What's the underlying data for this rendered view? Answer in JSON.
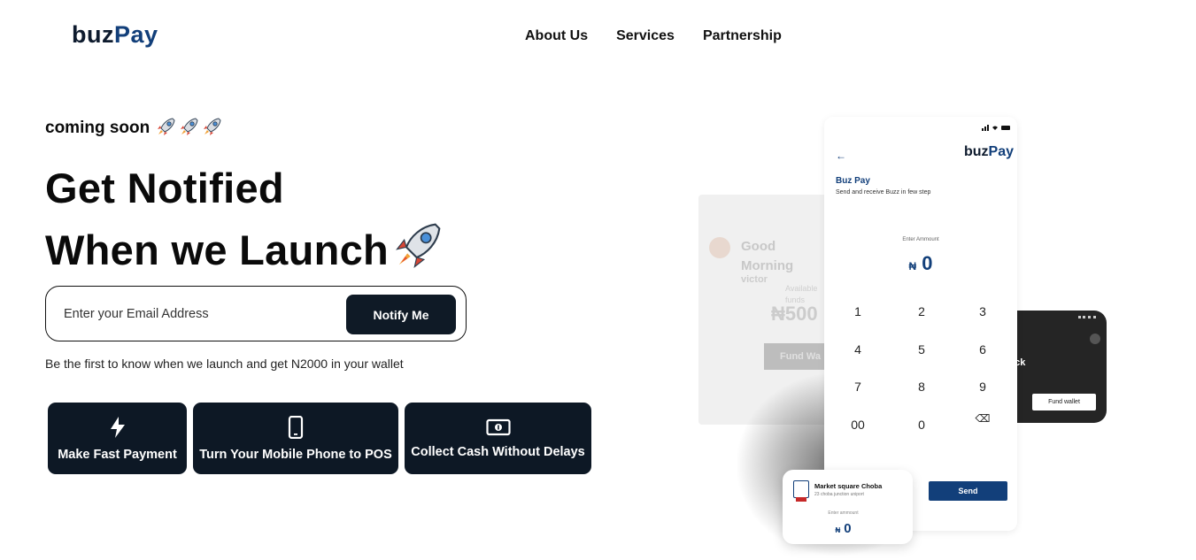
{
  "nav": {
    "logo_part1": "buz",
    "logo_part2": "Pay",
    "links": [
      "About Us",
      "Services",
      "Partnership"
    ]
  },
  "hero": {
    "coming_soon": "coming soon",
    "headline_line1": "Get Notified",
    "headline_line2": "When we Launch",
    "email_placeholder": "Enter your Email Address",
    "notify_button": "Notify Me",
    "subtext": "Be the first to know when we launch and get N2000 in your wallet"
  },
  "features": [
    {
      "label": "Make Fast Payment",
      "icon": "lightning-icon"
    },
    {
      "label": "Turn Your Mobile Phone to POS",
      "icon": "mobile-phone-icon"
    },
    {
      "label": "Collect Cash Without Delays",
      "icon": "cash-icon"
    }
  ],
  "illustration": {
    "back_card": {
      "greeting": "Good Morning",
      "name": "victor",
      "available": "Available funds",
      "amount": "₦500",
      "button": "Fund Wa"
    },
    "dark_card": {
      "text": "ack",
      "button": "Fund wallet"
    },
    "phone": {
      "back_arrow": "←",
      "logo_part1": "buz",
      "logo_part2": "Pay",
      "title": "Buz Pay",
      "subtitle": "Send and receive Buzz in few step",
      "enter_label": "Enter Ammount",
      "currency": "₦",
      "amount": "0",
      "keys": [
        "1",
        "2",
        "3",
        "4",
        "5",
        "6",
        "7",
        "8",
        "9",
        "00",
        "0",
        "⌫"
      ],
      "send": "Send"
    },
    "market_card": {
      "title": "Market square Choba",
      "subtitle": "23 choba junction uniport",
      "enter_label": "Enter ammount",
      "currency": "₦",
      "amount": "0"
    }
  },
  "colors": {
    "brand_dark": "#0e1b2e",
    "brand_blue": "#123f7a",
    "feature_bg": "#0d1825"
  }
}
